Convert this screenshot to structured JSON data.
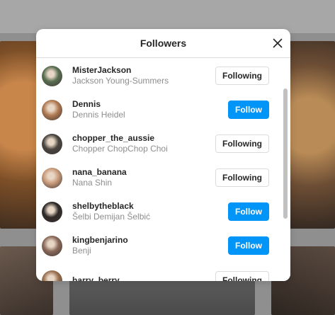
{
  "modal": {
    "title": "Followers",
    "close_icon": "close-icon"
  },
  "followers": [
    {
      "username": "MisterJackson",
      "fullname": "Jackson Young-Summers",
      "button": "Following",
      "state": "following",
      "avatar_color": "#5a6f52"
    },
    {
      "username": "Dennis",
      "fullname": "Dennis Heidel",
      "button": "Follow",
      "state": "follow",
      "avatar_color": "#b07a52"
    },
    {
      "username": "chopper_the_aussie",
      "fullname": "Chopper ChopChop Choi",
      "button": "Following",
      "state": "following",
      "avatar_color": "#4a4540"
    },
    {
      "username": "nana_banana",
      "fullname": "Nana Shin",
      "button": "Following",
      "state": "following",
      "avatar_color": "#c89a7a"
    },
    {
      "username": "shelbytheblack",
      "fullname": "Šelbi Demijan Šelbić",
      "button": "Follow",
      "state": "follow",
      "avatar_color": "#2f2a28"
    },
    {
      "username": "kingbenjarino",
      "fullname": "Benji",
      "button": "Follow",
      "state": "follow",
      "avatar_color": "#8a6a5a"
    },
    {
      "username": "harry_berry",
      "fullname": "",
      "button": "Following",
      "state": "following",
      "avatar_color": "#9a7050"
    }
  ],
  "colors": {
    "follow_blue": "#0095f6",
    "text_primary": "#262626",
    "text_secondary": "#8e8e8e",
    "border": "#dbdbdb"
  }
}
